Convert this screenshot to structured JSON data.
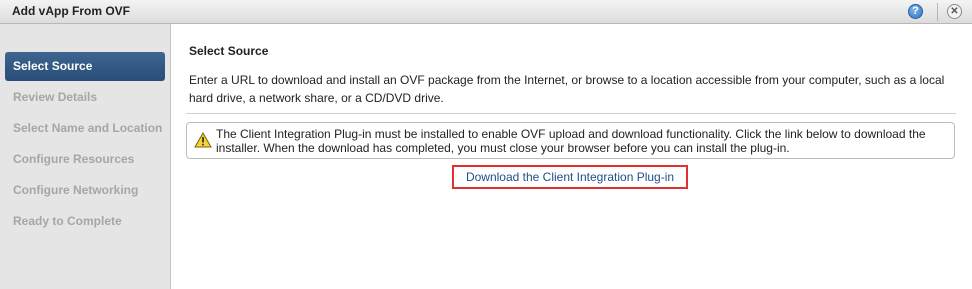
{
  "window": {
    "title": "Add vApp From OVF"
  },
  "icons": {
    "help": "help-icon",
    "close": "close-icon",
    "warning": "warning-icon"
  },
  "help_glyph": "?",
  "close_glyph": "✕",
  "steps": [
    {
      "label": "Select Source",
      "active": true
    },
    {
      "label": "Review Details",
      "active": false
    },
    {
      "label": "Select Name and Location",
      "active": false
    },
    {
      "label": "Configure Resources",
      "active": false
    },
    {
      "label": "Configure Networking",
      "active": false
    },
    {
      "label": "Ready to Complete",
      "active": false
    }
  ],
  "main": {
    "section_title": "Select Source",
    "description": "Enter a URL to download and install an OVF package from the Internet, or browse to a location accessible from your computer, such as a local hard drive, a network share, or a CD/DVD drive.",
    "warning": "The Client Integration Plug-in must be installed to enable OVF upload and download functionality. Click the link below to download the installer. When the download has completed, you must close your browser before you can install the plug-in.",
    "download_link": "Download the Client Integration Plug-in"
  },
  "colors": {
    "active_step": "#2f5680",
    "link": "#1f4f8a",
    "highlight_border": "#e03030",
    "warning_yellow": "#f5d23a"
  }
}
